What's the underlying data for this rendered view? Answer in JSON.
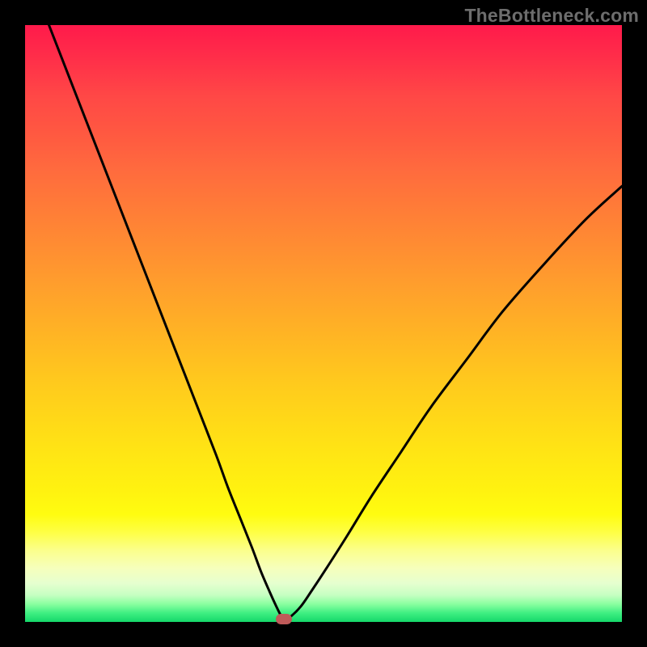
{
  "watermark": "TheBottleneck.com",
  "chart_data": {
    "type": "line",
    "title": "",
    "xlabel": "",
    "ylabel": "",
    "xlim": [
      0,
      100
    ],
    "ylim": [
      0,
      100
    ],
    "series": [
      {
        "name": "bottleneck-curve",
        "x": [
          4,
          7.5,
          11,
          14.5,
          18,
          21.5,
          25,
          28.5,
          32,
          34,
          36,
          38,
          39.5,
          41,
          42,
          42.8,
          43.5,
          44.5,
          46.2,
          48,
          50.5,
          54,
          58,
          63,
          68,
          74,
          80,
          87,
          94,
          100
        ],
        "values": [
          100,
          91,
          82,
          73,
          64,
          55,
          46,
          37,
          28,
          22.5,
          17.5,
          12.5,
          8.5,
          5,
          2.8,
          1.2,
          0.4,
          0.9,
          2.6,
          5.2,
          9,
          14.5,
          21,
          28.5,
          36,
          44,
          52,
          60,
          67.5,
          73
        ]
      }
    ],
    "annotations": [
      {
        "name": "minimum-marker",
        "x": 43.3,
        "y": 0.6,
        "color": "#bf5a59"
      }
    ],
    "background_gradient": {
      "top": "#ff1a4b",
      "mid": "#ffd818",
      "bottom": "#15d86a"
    }
  }
}
